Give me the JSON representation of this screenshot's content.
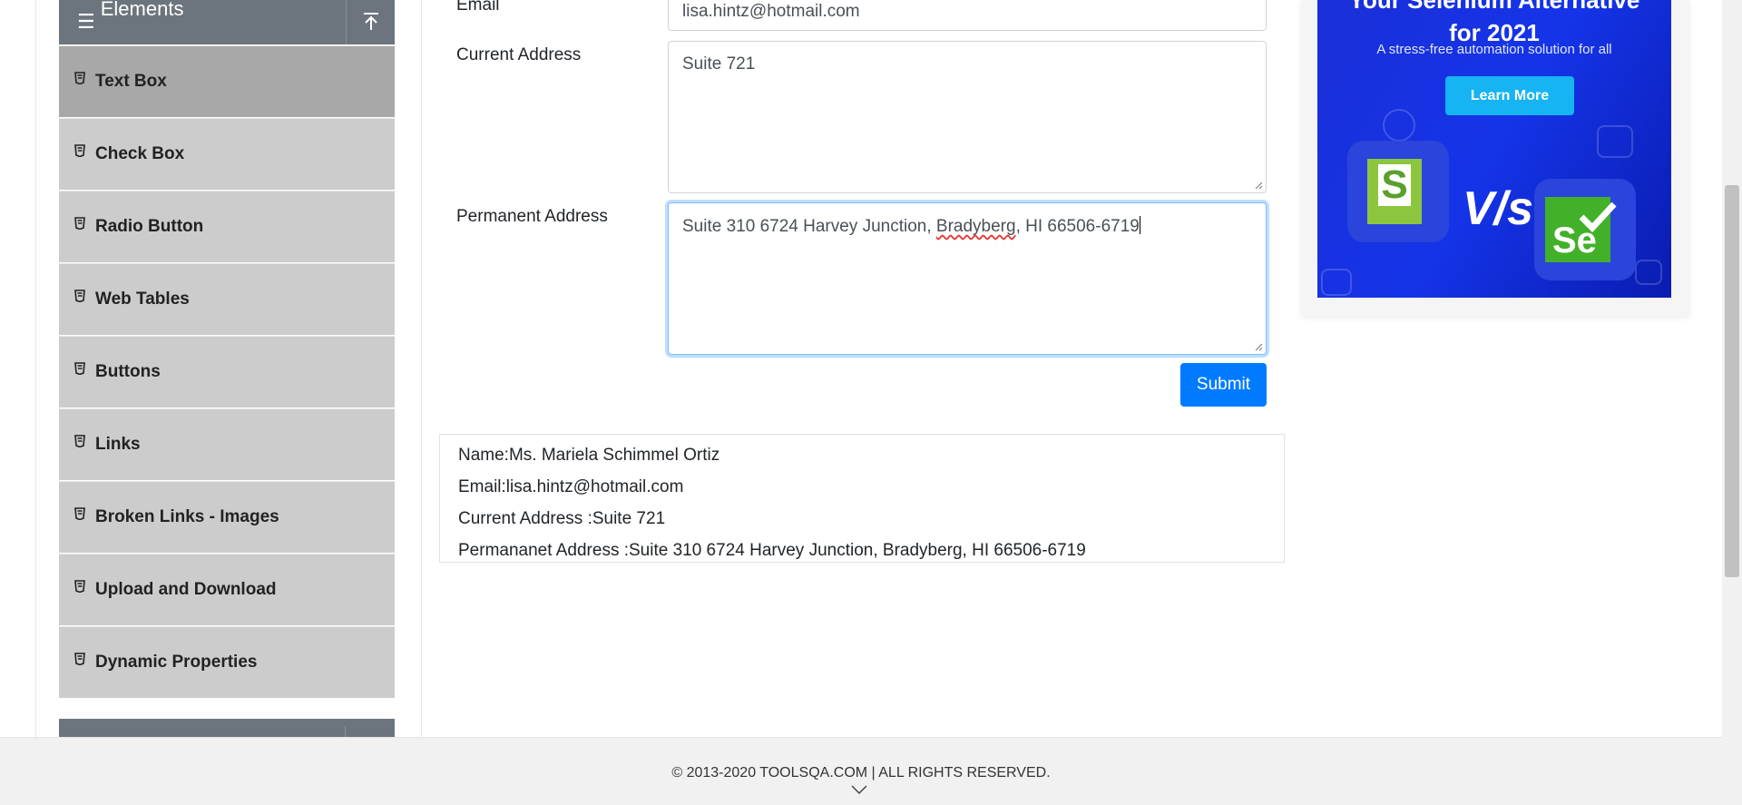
{
  "sidebar": {
    "group_title": "Elements",
    "items": [
      {
        "label": "Text Box",
        "active": true
      },
      {
        "label": "Check Box",
        "active": false
      },
      {
        "label": "Radio Button",
        "active": false
      },
      {
        "label": "Web Tables",
        "active": false
      },
      {
        "label": "Buttons",
        "active": false
      },
      {
        "label": "Links",
        "active": false
      },
      {
        "label": "Broken Links - Images",
        "active": false
      },
      {
        "label": "Upload and Download",
        "active": false
      },
      {
        "label": "Dynamic Properties",
        "active": false
      }
    ]
  },
  "form": {
    "email_label": "Email",
    "email_value": "lisa.hintz@hotmail.com",
    "current_address_label": "Current Address",
    "current_address_value": "Suite 721",
    "permanent_address_label": "Permanent Address",
    "permanent_address_value_a": "Suite 310 6724 Harvey Junction, ",
    "permanent_address_value_misspelled": "Bradyberg",
    "permanent_address_value_b": ", HI 66506-6719",
    "submit_label": "Submit"
  },
  "output": {
    "name": "Name:Ms. Mariela Schimmel Ortiz",
    "email": "Email:lisa.hintz@hotmail.com",
    "current_address": "Current Address :Suite 721",
    "permanent_address": "Permananet Address :Suite 310 6724 Harvey Junction, Bradyberg, HI 66506-6719"
  },
  "ad": {
    "title_line1": "Your Selenium Alternative",
    "title_line2": "for 2021",
    "subtitle": "A stress-free automation solution for all",
    "button": "Learn More",
    "logo_s_letter": "S",
    "vs": "V/s",
    "logo_se_letters": "Se"
  },
  "footer": {
    "copyright": "© 2013-2020 TOOLSQA.COM | ALL RIGHTS RESERVED."
  },
  "colors": {
    "primary": "#007bff",
    "sidebar_header": "#6c757d",
    "menu_item": "#cccccc",
    "menu_item_active": "#a8a8a8"
  }
}
